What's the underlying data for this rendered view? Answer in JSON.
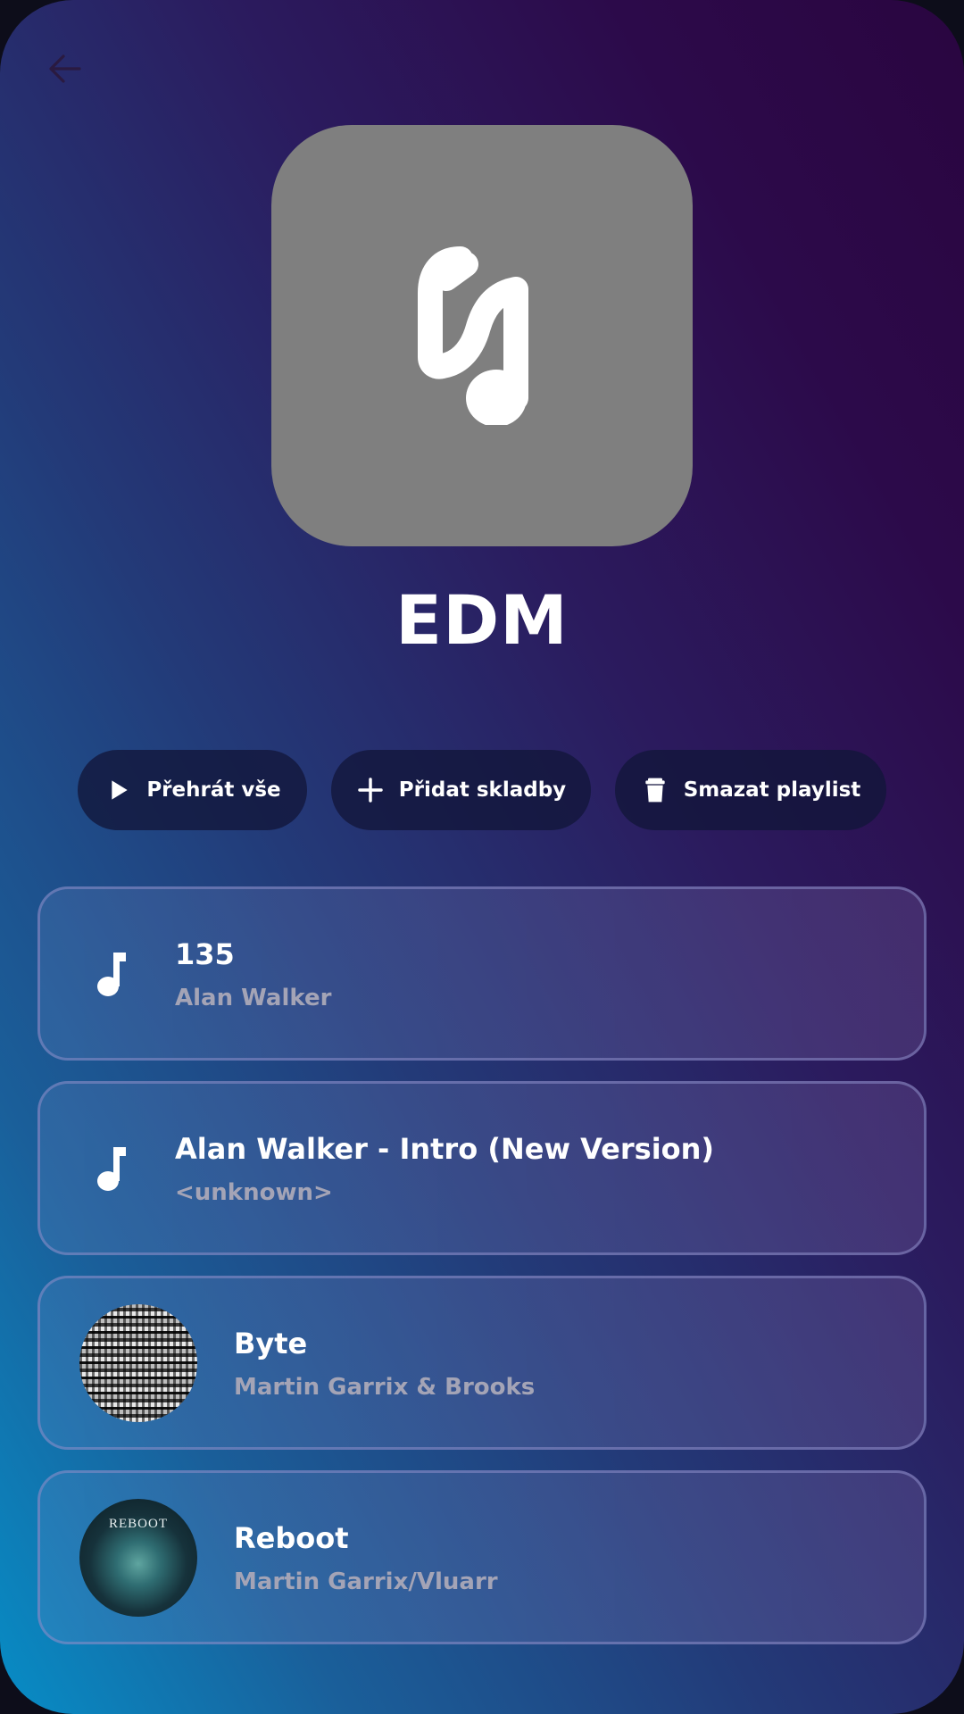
{
  "header": {
    "back_icon": "arrow-left-icon"
  },
  "playlist": {
    "cover_icon": "music-note-icon",
    "cover_color": "#7f7f7f",
    "title": "EDM"
  },
  "actions": {
    "play_all": {
      "label": "Přehrát vše",
      "icon": "play-icon"
    },
    "add_tracks": {
      "label": "Přidat skladby",
      "icon": "plus-icon"
    },
    "delete_playlist": {
      "label": "Smazat playlist",
      "icon": "trash-icon"
    }
  },
  "tracks": [
    {
      "title": "135",
      "artist": "Alan Walker",
      "artwork": "music-note-icon"
    },
    {
      "title": "Alan Walker - Intro (New Version)",
      "artist": "<unknown>",
      "artwork": "music-note-icon"
    },
    {
      "title": "Byte",
      "artist": "Martin Garrix & Brooks",
      "artwork": "album-art-byte"
    },
    {
      "title": "Reboot",
      "artist": "Martin Garrix/Vluarr",
      "artwork": "album-art-reboot",
      "artwork_text": "REBOOT"
    }
  ],
  "colors": {
    "gradient_bottom_left": "#078dc6",
    "gradient_top_right": "#2a0540",
    "button_background": "#12163a",
    "secondary_text": "#a4a4b6"
  }
}
